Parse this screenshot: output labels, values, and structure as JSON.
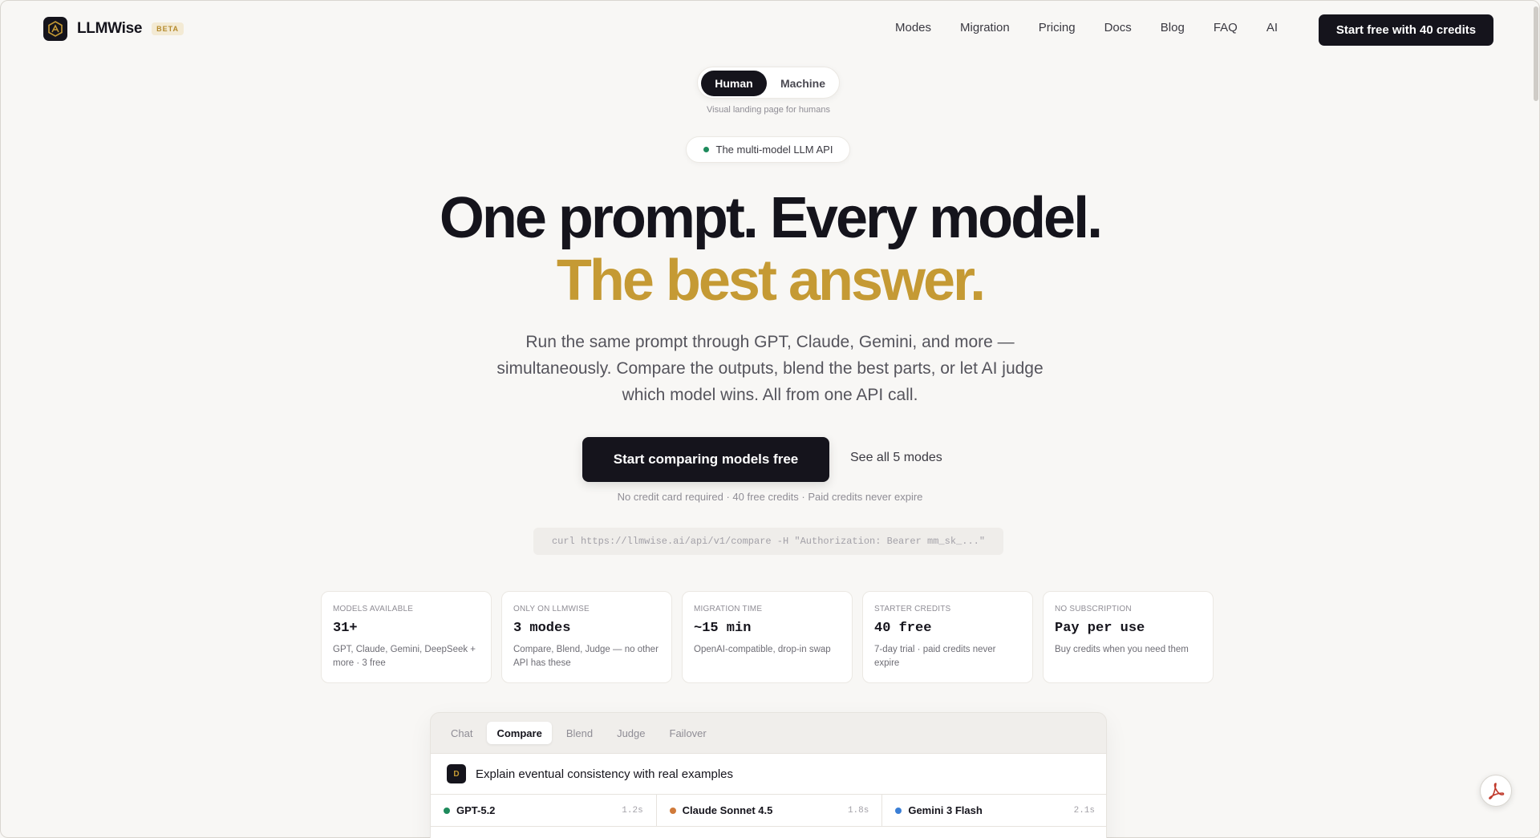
{
  "brand": {
    "name": "LLMWise",
    "badge": "BETA"
  },
  "nav": {
    "links": [
      "Modes",
      "Migration",
      "Pricing",
      "Docs",
      "Blog",
      "FAQ",
      "AI"
    ],
    "cta": "Start free with 40 credits"
  },
  "toggle": {
    "options": [
      "Human",
      "Machine"
    ],
    "selected": "Human",
    "caption": "Visual landing page for humans"
  },
  "pill": {
    "label": "The multi-model LLM API"
  },
  "hero": {
    "headline": "One prompt. Every model.",
    "headline_accent": "The best answer.",
    "subtitle_lines": [
      "Run the same prompt through GPT, Claude, Gemini, and more —",
      "simultaneously. Compare the outputs, blend the best parts, or let AI judge",
      "which model wins. All from one API call."
    ],
    "cta_primary": "Start comparing models free",
    "cta_secondary": "See all 5 modes",
    "fineprint": "No credit card required · 40 free credits · Paid credits never expire",
    "curl": "curl https://llmwise.ai/api/v1/compare -H \"Authorization: Bearer mm_sk_...\""
  },
  "stats": [
    {
      "label": "MODELS AVAILABLE",
      "value": "31+",
      "desc": "GPT, Claude, Gemini, DeepSeek + more · 3 free"
    },
    {
      "label": "ONLY ON LLMWISE",
      "value": "3 modes",
      "desc": "Compare, Blend, Judge — no other API has these"
    },
    {
      "label": "MIGRATION TIME",
      "value": "~15 min",
      "desc": "OpenAI-compatible, drop-in swap"
    },
    {
      "label": "STARTER CREDITS",
      "value": "40 free",
      "desc": "7-day trial · paid credits never expire"
    },
    {
      "label": "NO SUBSCRIPTION",
      "value": "Pay per use",
      "desc": "Buy credits when you need them"
    }
  ],
  "demo": {
    "tabs": [
      "Chat",
      "Compare",
      "Blend",
      "Judge",
      "Failover"
    ],
    "active_tab": "Compare",
    "avatar_letter": "D",
    "prompt": "Explain eventual consistency with real examples",
    "models": [
      {
        "name": "GPT-5.2",
        "latency": "1.2s",
        "color": "#1e8a5c"
      },
      {
        "name": "Claude Sonnet 4.5",
        "latency": "1.8s",
        "color": "#d07a3a"
      },
      {
        "name": "Gemini 3 Flash",
        "latency": "2.1s",
        "color": "#3b7fd6"
      }
    ]
  },
  "colors": {
    "accent": "#c59a34",
    "dark": "#15141c",
    "background": "#f8f7f5"
  },
  "icons": {
    "logo": "llmwise-logo-icon",
    "pdf": "pdf-icon"
  }
}
